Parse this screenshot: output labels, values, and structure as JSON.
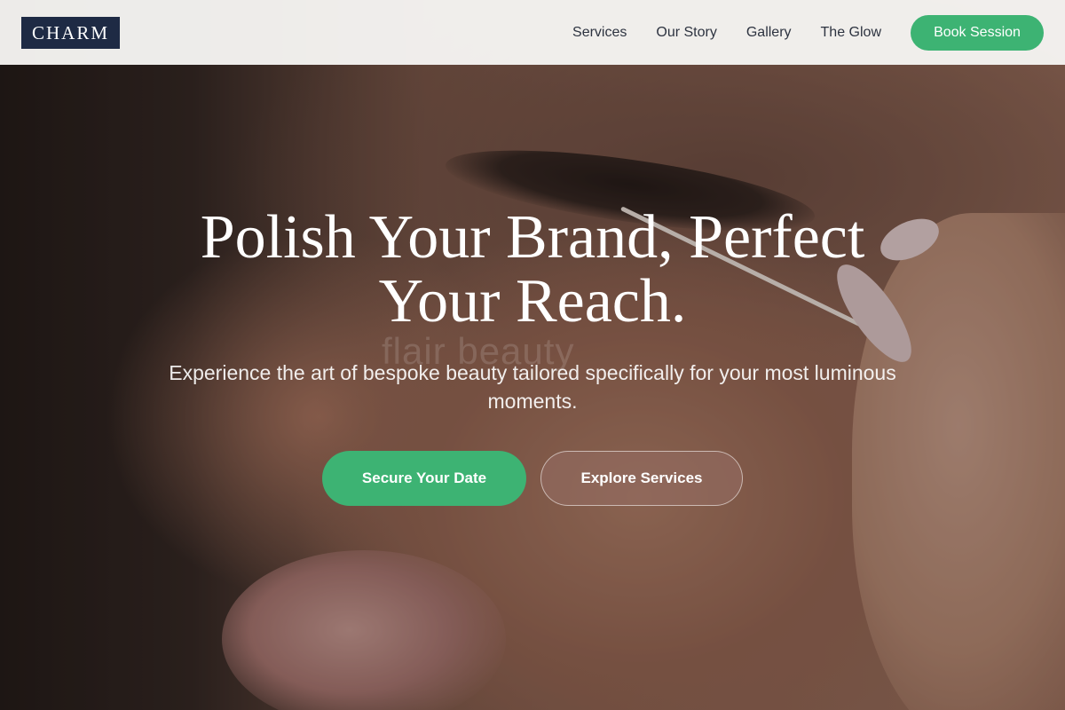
{
  "brand": {
    "logo_text": "CHARM"
  },
  "nav": {
    "links": [
      "Services",
      "Our Story",
      "Gallery",
      "The Glow"
    ],
    "cta_label": "Book Session"
  },
  "hero": {
    "headline": "Polish Your Brand, Perfect Your Reach.",
    "subtitle": "Experience the art of bespoke beauty tailored specifically for your most luminous moments.",
    "primary_cta": "Secure Your Date",
    "secondary_cta": "Explore Services",
    "watermark_text": "flair beauty"
  },
  "colors": {
    "accent": "#3db373",
    "logo_bg": "#1e2a44",
    "nav_bg": "#f6f5f3",
    "nav_text": "#2d3340"
  }
}
